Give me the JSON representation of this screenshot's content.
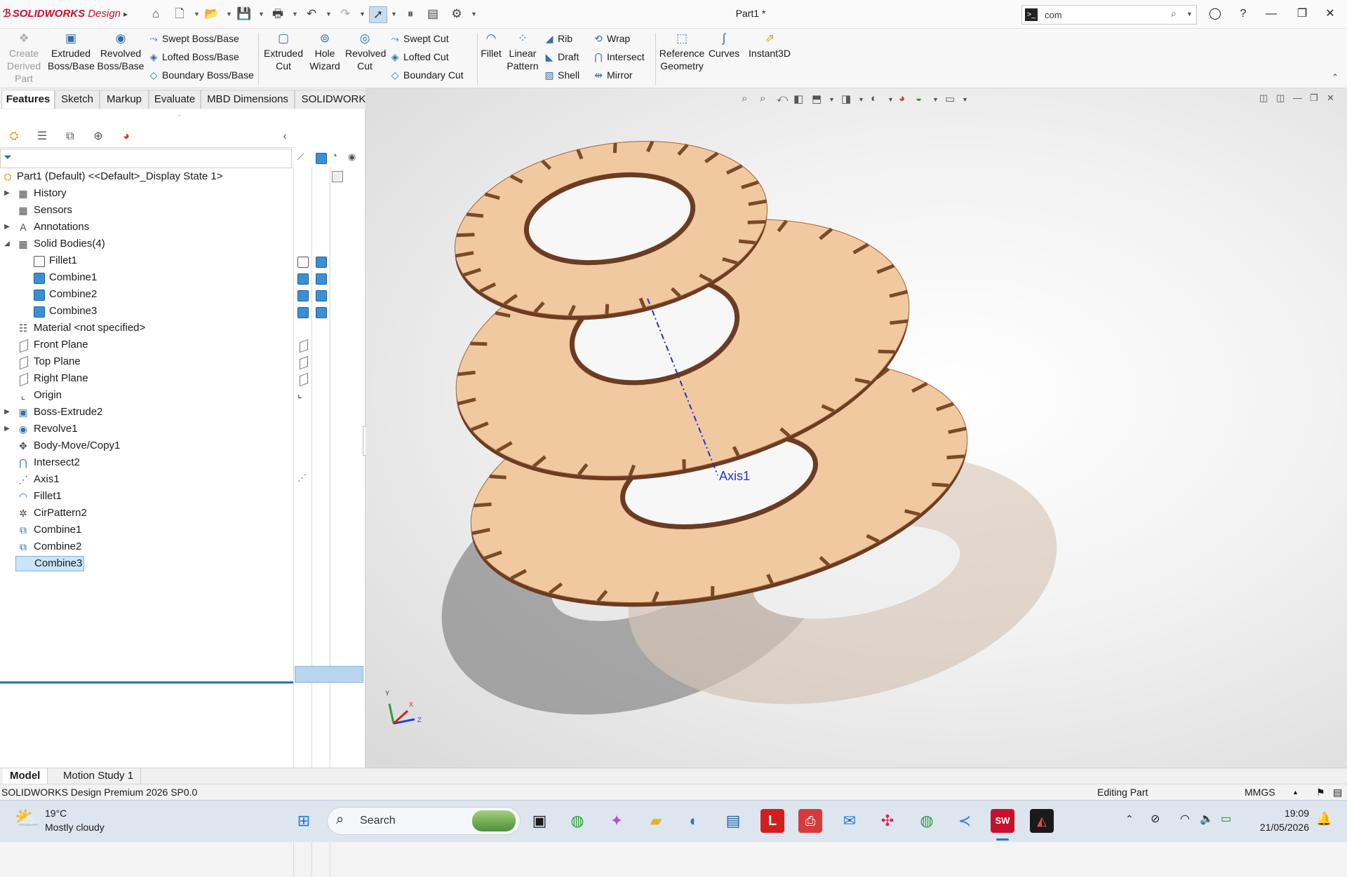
{
  "app": {
    "logo_brand": "SOLIDWORKS",
    "logo_suffix": "Design",
    "document_title": "Part1 *",
    "search_value": "com"
  },
  "commands": {
    "create_derived_part": "Create Derived Part",
    "extruded_boss": "Extruded Boss/Base",
    "revolved_boss": "Revolved Boss/Base",
    "swept_boss": "Swept Boss/Base",
    "lofted_boss": "Lofted Boss/Base",
    "boundary_boss": "Boundary Boss/Base",
    "extruded_cut": "Extruded Cut",
    "hole_wizard": "Hole Wizard",
    "revolved_cut": "Revolved Cut",
    "swept_cut": "Swept Cut",
    "lofted_cut": "Lofted Cut",
    "boundary_cut": "Boundary Cut",
    "fillet": "Fillet",
    "linear_pattern": "Linear Pattern",
    "rib": "Rib",
    "draft": "Draft",
    "shell": "Shell",
    "wrap": "Wrap",
    "intersect": "Intersect",
    "mirror": "Mirror",
    "reference_geometry": "Reference Geometry",
    "curves": "Curves",
    "instant3d": "Instant3D"
  },
  "tabs": [
    "Features",
    "Sketch",
    "Markup",
    "Evaluate",
    "MBD Dimensions",
    "SOLIDWORKS Add-Ins"
  ],
  "tree": {
    "root": "Part1 (Default) <<Default>_Display State 1>",
    "items": [
      "History",
      "Sensors",
      "Annotations",
      "Solid Bodies(4)",
      "Fillet1",
      "Combine1",
      "Combine2",
      "Combine3",
      "Material <not specified>",
      "Front Plane",
      "Top Plane",
      "Right Plane",
      "Origin",
      "Boss-Extrude2",
      "Revolve1",
      "Body-Move/Copy1",
      "Intersect2",
      "Axis1",
      "Fillet1",
      "CirPattern2",
      "Combine1",
      "Combine2",
      "Combine3"
    ]
  },
  "viewport": {
    "axis_label": "Axis1",
    "triad_x": "X",
    "triad_y": "Y",
    "triad_z": "Z",
    "accent_color": "#2f6fad",
    "part_color": "#f1c9a0"
  },
  "bottom_tabs": [
    "Model",
    "Motion Study 1"
  ],
  "status": {
    "product": "SOLIDWORKS Design Premium 2026 SP0.0",
    "mode": "Editing Part",
    "units": "MMGS"
  },
  "taskbar": {
    "weather_temp": "19°C",
    "weather_desc": "Mostly cloudy",
    "search_label": "Search",
    "time": "19:09",
    "date": "21/05/2026"
  }
}
